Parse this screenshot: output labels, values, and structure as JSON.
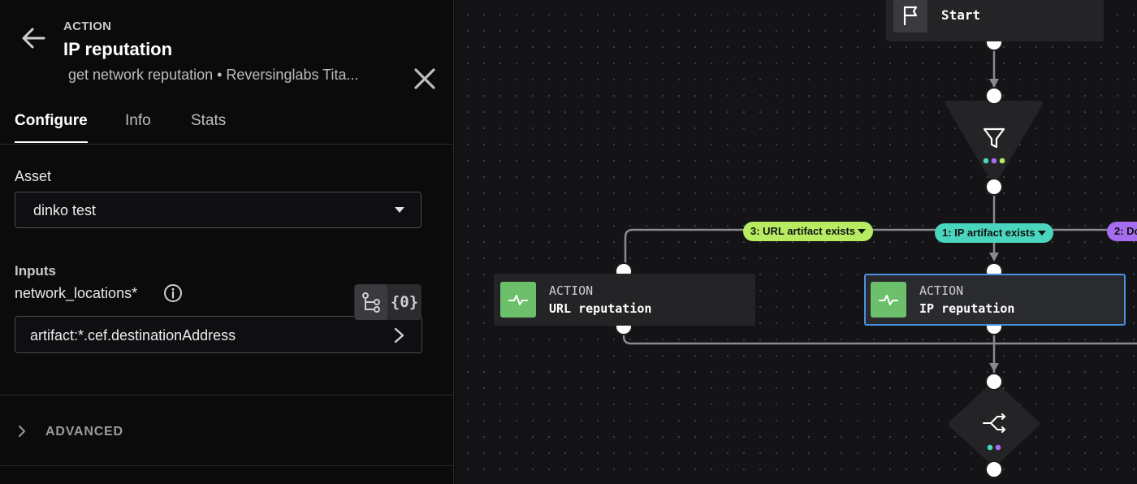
{
  "panel": {
    "eyebrow": "ACTION",
    "title": "IP reputation",
    "subtitle": "get network reputation  •  Reversinglabs Tita...",
    "tabs": [
      {
        "label": "Configure",
        "active": true
      },
      {
        "label": "Info",
        "active": false
      },
      {
        "label": "Stats",
        "active": false
      }
    ],
    "asset_label": "Asset",
    "asset_value": "dinko test",
    "inputs_label": "Inputs",
    "field_label": "network_locations*",
    "field_value": "artifact:*.cef.destinationAddress",
    "brace_label": "{0}",
    "advanced_label": "ADVANCED"
  },
  "canvas": {
    "start_label": "Start",
    "pills": [
      {
        "label": "3: URL artifact exists",
        "color": "#b7ec62"
      },
      {
        "label": "1: IP artifact exists",
        "color": "#4ad6be"
      },
      {
        "label": "2: Do",
        "color": "#a66df0"
      }
    ],
    "nodes": [
      {
        "type": "ACTION",
        "name": "URL reputation",
        "selected": false
      },
      {
        "type": "ACTION",
        "name": "IP reputation",
        "selected": true
      }
    ],
    "filter_dots": [
      "#4ad6be",
      "#a66df0",
      "#b7ec62"
    ],
    "join_dots": [
      "#4ad6be",
      "#a66df0"
    ]
  },
  "icons": {
    "back": "arrow-left-icon",
    "close": "close-icon",
    "info": "info-circle-icon",
    "tree": "tree-branch-icon",
    "chevron": "chevron-right-icon",
    "flag": "flag-icon",
    "filter": "filter-icon",
    "pulse": "pulse-icon",
    "join": "merge-arrows-icon"
  },
  "colors": {
    "accent_selected": "#4a90e2",
    "action_icon_bg": "#6cc06c"
  }
}
